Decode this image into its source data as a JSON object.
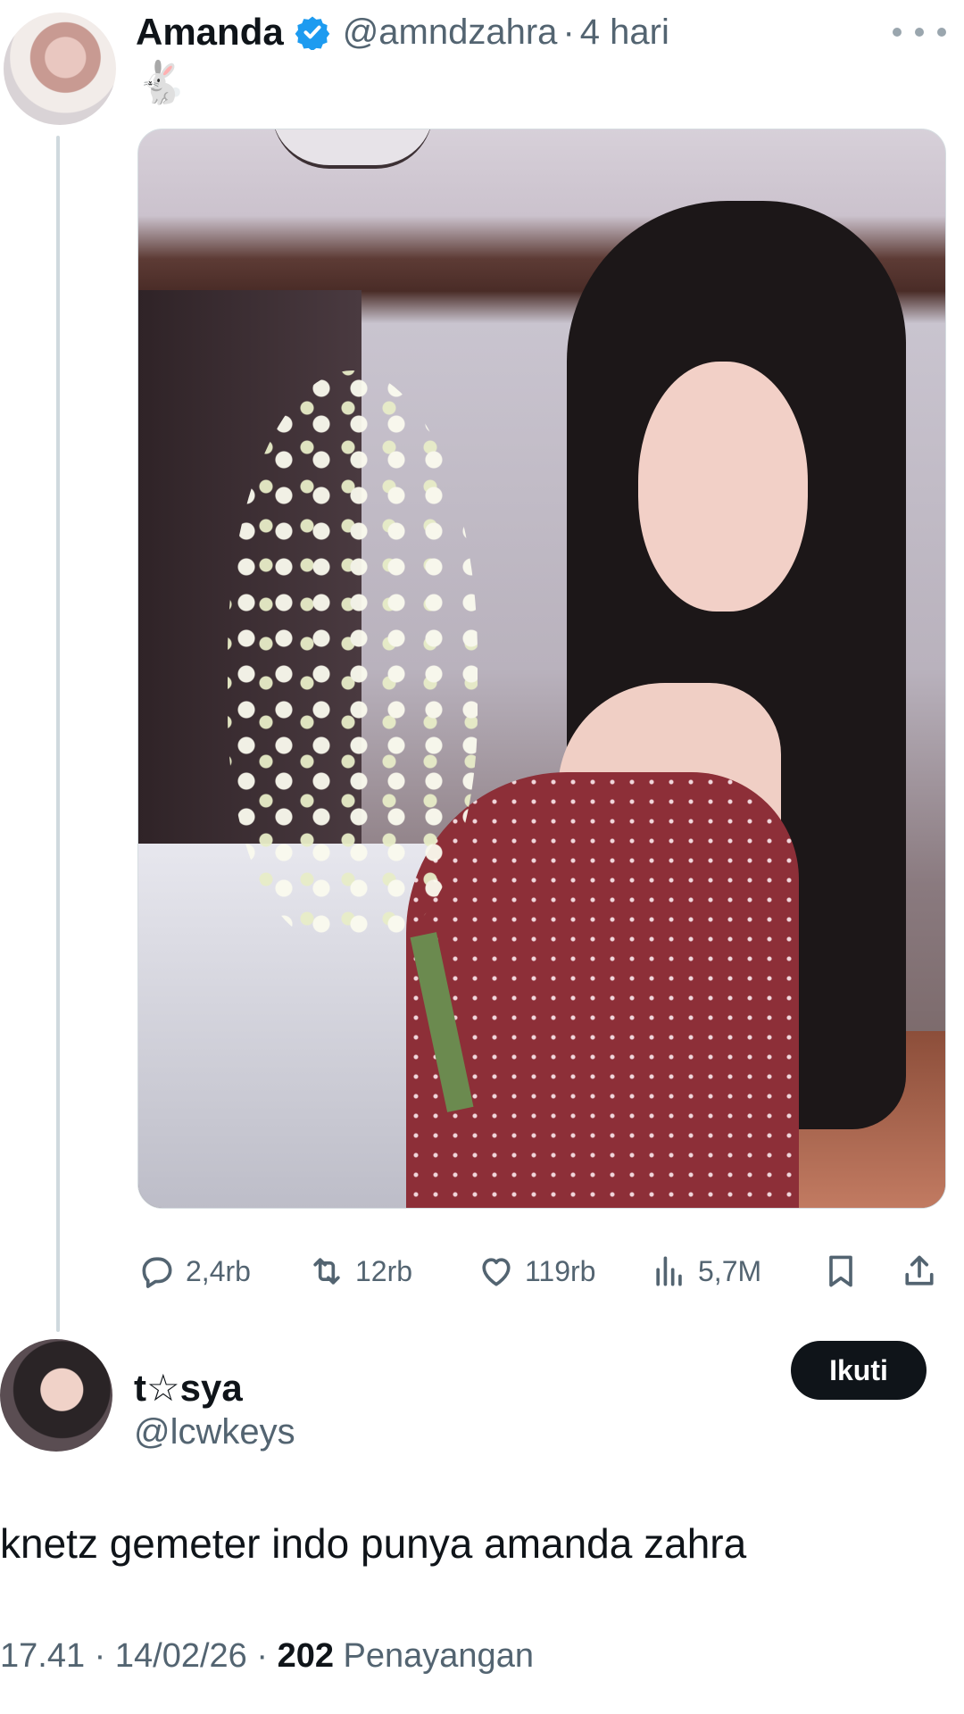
{
  "parent_tweet": {
    "display_name": "Amanda",
    "handle": "@amndzahra",
    "separator": "·",
    "time_ago": "4 hari",
    "text": "🐇",
    "actions": {
      "replies": "2,4rb",
      "retweets": "12rb",
      "likes": "119rb",
      "views": "5,7M"
    }
  },
  "reply": {
    "display_name": "t☆sya",
    "handle": "@lcwkeys",
    "follow_label": "Ikuti",
    "text": "knetz gemeter indo punya amanda zahra",
    "time": "17.41",
    "date": "14/02/26",
    "separator": "·",
    "views_count": "202",
    "views_label": "Penayangan"
  },
  "colors": {
    "text_primary": "#0f1419",
    "text_secondary": "#536471",
    "verified_blue": "#1d9bf0",
    "thread_line": "#cfd9de"
  },
  "icons": [
    "verified-badge-icon",
    "more-icon",
    "reply-icon",
    "retweet-icon",
    "like-icon",
    "views-icon",
    "bookmark-icon",
    "share-icon"
  ]
}
